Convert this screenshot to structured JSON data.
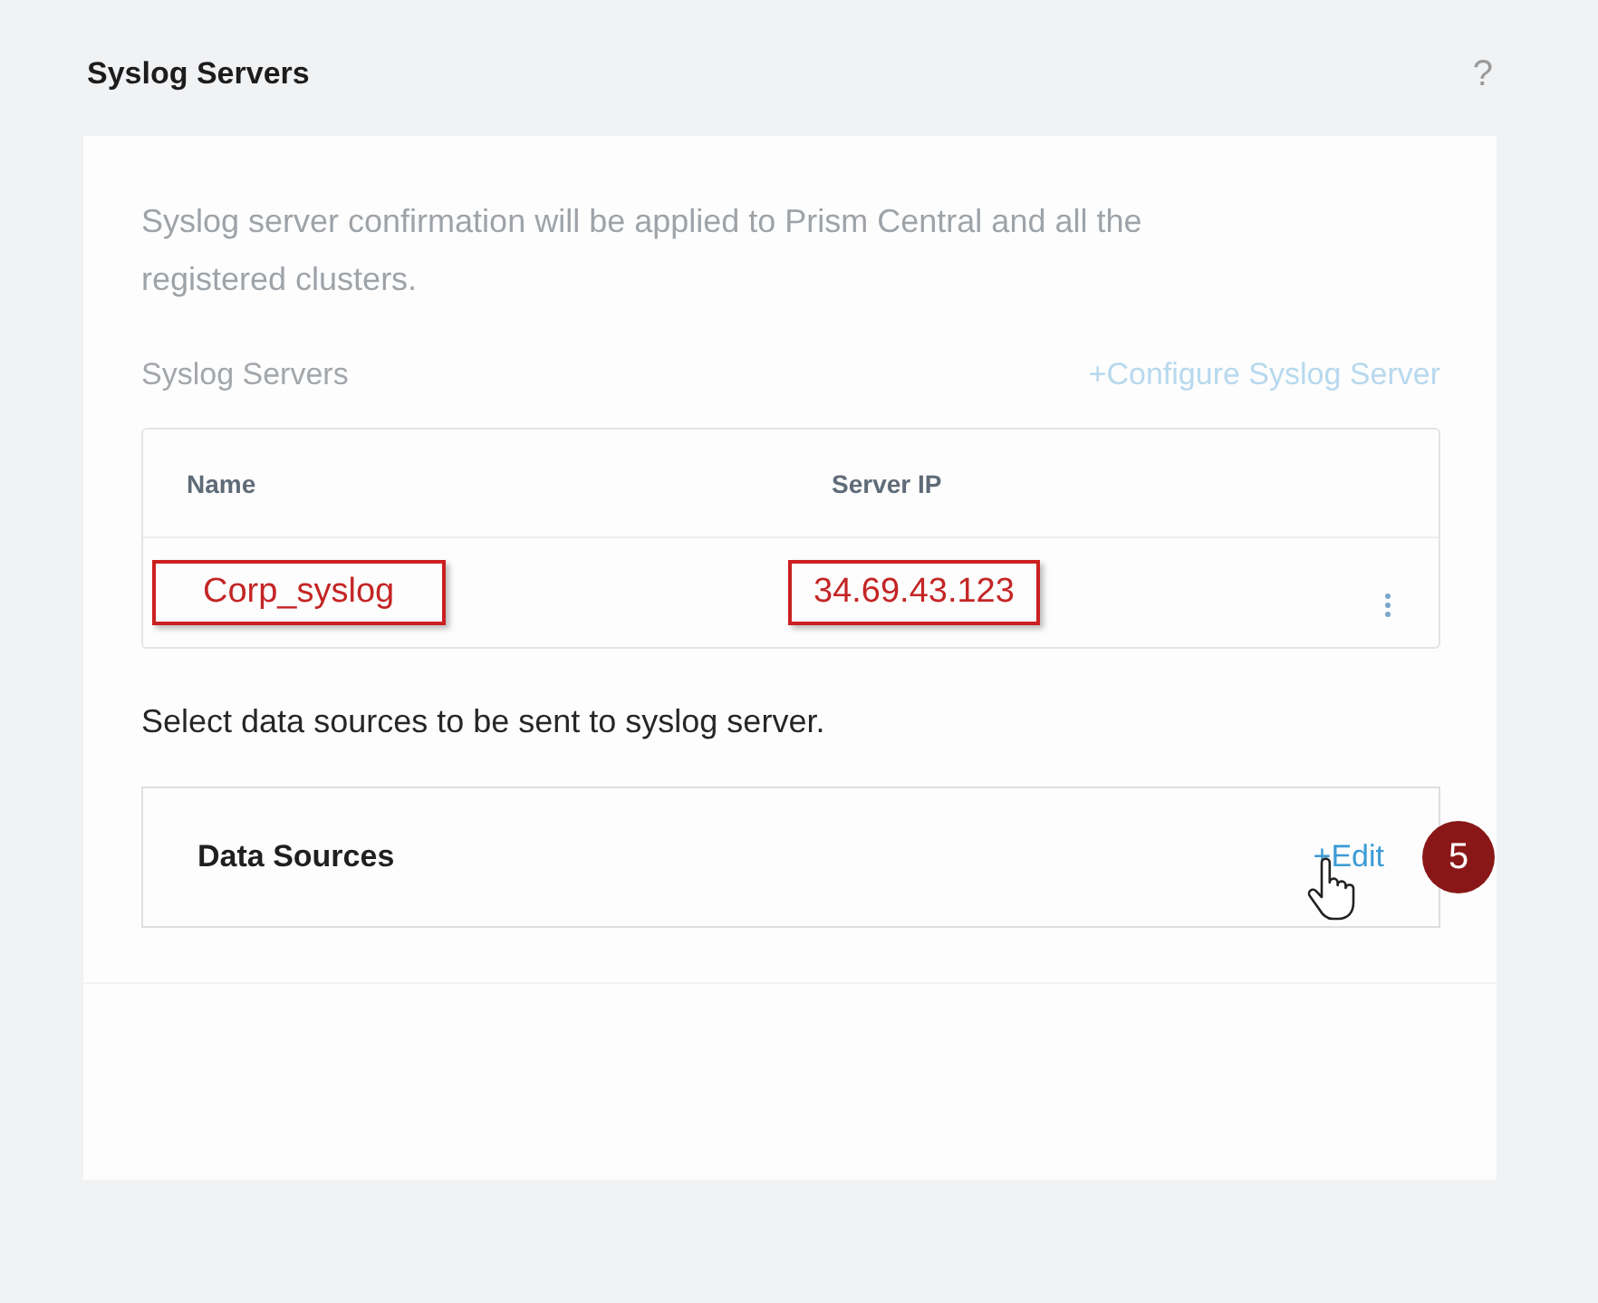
{
  "panel": {
    "title": "Syslog Servers",
    "help": "?"
  },
  "description": "Syslog server confirmation will be applied to Prism Central and all the registered clusters.",
  "servers_section": {
    "label": "Syslog Servers",
    "action": "+Configure Syslog Server"
  },
  "table": {
    "columns": [
      "Name",
      "Server IP"
    ],
    "rows": [
      {
        "cells": [
          "Corp_syslog",
          "34.69.43.123"
        ],
        "highlighted": true
      }
    ]
  },
  "data_sources_prompt": "Select data sources to be sent to syslog server.",
  "data_sources": {
    "title": "Data Sources",
    "action": "+Edit",
    "hovered": true,
    "step_badge": "5"
  }
}
